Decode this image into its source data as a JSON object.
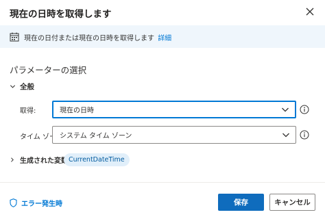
{
  "dialog": {
    "title": "現在の日時を取得します"
  },
  "banner": {
    "description": "現在の日付または現在の日時を取得します",
    "details_link": "詳細"
  },
  "parameters": {
    "section_title": "パラメーターの選択",
    "general_group": "全般",
    "fields": [
      {
        "label": "取得:",
        "value": "現在の日時"
      },
      {
        "label": "タイム ゾーン:",
        "value": "システム タイム ゾーン"
      }
    ],
    "generated_variables_label": "生成された変数",
    "generated_variable": "CurrentDateTime"
  },
  "footer": {
    "on_error": "エラー発生時",
    "save": "保存",
    "cancel": "キャンセル"
  },
  "colors": {
    "accent": "#0078d4",
    "primary_button": "#0f6cbd",
    "banner_bg": "#eff6fc"
  },
  "icons": {
    "close": "close-icon",
    "calendar": "calendar-icon",
    "chevron_down": "chevron-down-icon",
    "chevron_right": "chevron-right-icon",
    "info": "info-icon",
    "shield": "shield-icon"
  }
}
